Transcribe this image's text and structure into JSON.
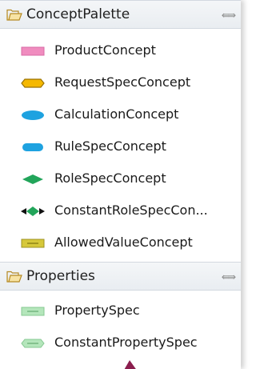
{
  "concept_palette": {
    "title": "ConceptPalette",
    "items": [
      {
        "label": "ProductConcept",
        "icon": "pink-rectangle-icon",
        "color": "#f08cbf"
      },
      {
        "label": "RequestSpecConcept",
        "icon": "orange-hexagon-icon",
        "color": "#e8a800"
      },
      {
        "label": "CalculationConcept",
        "icon": "blue-ellipse-icon",
        "color": "#1e9bd9"
      },
      {
        "label": "RuleSpecConcept",
        "icon": "blue-rounded-rect-icon",
        "color": "#1e9bd9"
      },
      {
        "label": "RoleSpecConcept",
        "icon": "green-diamond-icon",
        "color": "#22a55a"
      },
      {
        "label": "ConstantRoleSpecCon...",
        "icon": "green-diamond-arrows-icon",
        "color": "#22a55a"
      },
      {
        "label": "AllowedValueConcept",
        "icon": "olive-rectangle-icon",
        "color": "#c9bf2c"
      }
    ]
  },
  "properties": {
    "title": "Properties",
    "items": [
      {
        "label": "PropertySpec",
        "icon": "light-green-rectangle-icon",
        "color": "#a8e0b0"
      },
      {
        "label": "ConstantPropertySpec",
        "icon": "light-green-hexagon-icon",
        "color": "#a8e0b0"
      }
    ]
  }
}
